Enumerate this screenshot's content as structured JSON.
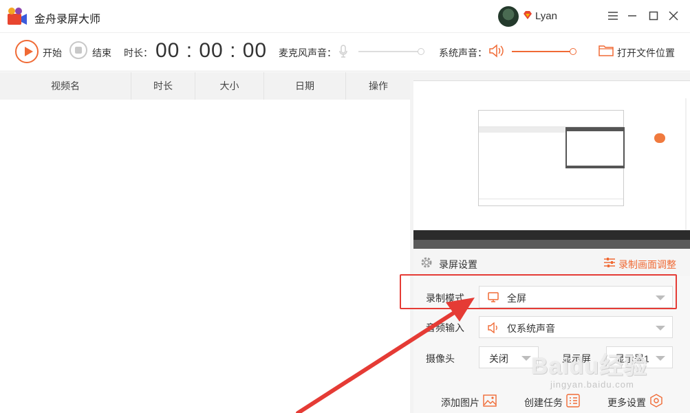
{
  "app": {
    "title": "金舟录屏大师",
    "username": "Lyan",
    "window_controls": {
      "menu": "☰",
      "minimize": "—",
      "maximize": "☐",
      "close": "✕"
    }
  },
  "toolbar": {
    "start_label": "开始",
    "stop_label": "结束",
    "duration_label": "时长：",
    "timer": "00 : 00 : 00",
    "mic_label": "麦克风声音：",
    "mic_level": 0,
    "system_audio_label": "系统声音：",
    "system_audio_level": 1.0,
    "open_folder_label": "打开文件位置"
  },
  "table": {
    "columns": [
      "视频名",
      "时长",
      "大小",
      "日期",
      "操作"
    ],
    "rows": []
  },
  "settings": {
    "header_label": "录屏设置",
    "adjust_label": "录制画面调整",
    "record_mode_label": "录制模式",
    "record_mode_value": "全屏",
    "audio_input_label": "音频输入",
    "audio_input_value": "仅系统声音",
    "camera_label": "摄像头",
    "camera_value": "关闭",
    "display_label": "显示屏",
    "display_value": "显示器1"
  },
  "actions": {
    "add_image": "添加图片",
    "create_task": "创建任务",
    "more_settings": "更多设置"
  },
  "watermark": {
    "main": "Baidu经验",
    "sub": "jingyan.baidu.com"
  },
  "colors": {
    "accent": "#f06a35",
    "annotation_red": "#e53b35"
  }
}
